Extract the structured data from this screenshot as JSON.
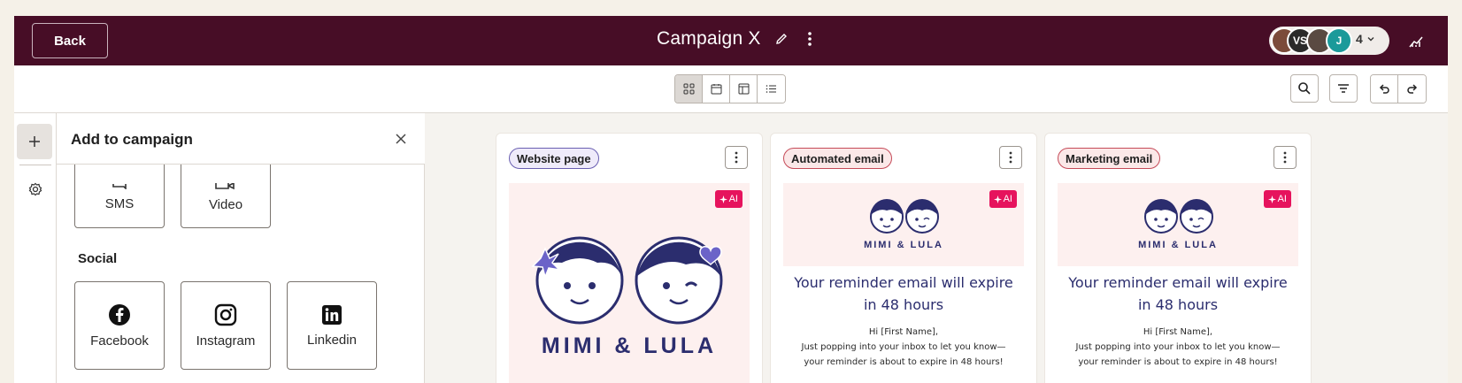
{
  "header": {
    "back_label": "Back",
    "title": "Campaign X",
    "avatars": [
      {
        "initials": "",
        "color": "#7b4b3a"
      },
      {
        "initials": "VS",
        "color": "#2a2a2a"
      },
      {
        "initials": "",
        "color": "#5a4a42"
      },
      {
        "initials": "J",
        "color": "#1b9a9a"
      }
    ],
    "collaborator_count": "4"
  },
  "toolbar": {
    "views": [
      "grid-view",
      "calendar-view",
      "board-view",
      "list-view"
    ],
    "active_view": "grid-view"
  },
  "panel": {
    "title": "Add to campaign",
    "tiles_top": [
      {
        "label": "SMS",
        "icon": "sms-icon"
      },
      {
        "label": "Video",
        "icon": "video-icon"
      }
    ],
    "social_title": "Social",
    "social_tiles": [
      {
        "label": "Facebook",
        "icon": "facebook-icon"
      },
      {
        "label": "Instagram",
        "icon": "instagram-icon"
      },
      {
        "label": "Linkedin",
        "icon": "linkedin-icon"
      }
    ]
  },
  "cards": [
    {
      "tag": "Website page",
      "ai": "AI",
      "brand": "MIMI & LULA"
    },
    {
      "tag": "Automated email",
      "ai": "AI",
      "brand": "MIMI & LULA",
      "headline": "Your reminder email will expire in 48 hours",
      "greeting": "Hi [First Name],",
      "body": "Just popping into your inbox to let you know—your reminder is about to expire in 48 hours!"
    },
    {
      "tag": "Marketing email",
      "ai": "AI",
      "brand": "MIMI & LULA",
      "headline": "Your reminder email will expire in 48 hours",
      "greeting": "Hi [First Name],",
      "body": "Just popping into your inbox to let you know—your reminder is about to expire in 48 hours!"
    }
  ],
  "colors": {
    "header_bg": "#470d26",
    "ai_badge": "#e6135d",
    "brand_navy": "#2b2d6e",
    "preview_bg": "#fdf0ef"
  }
}
